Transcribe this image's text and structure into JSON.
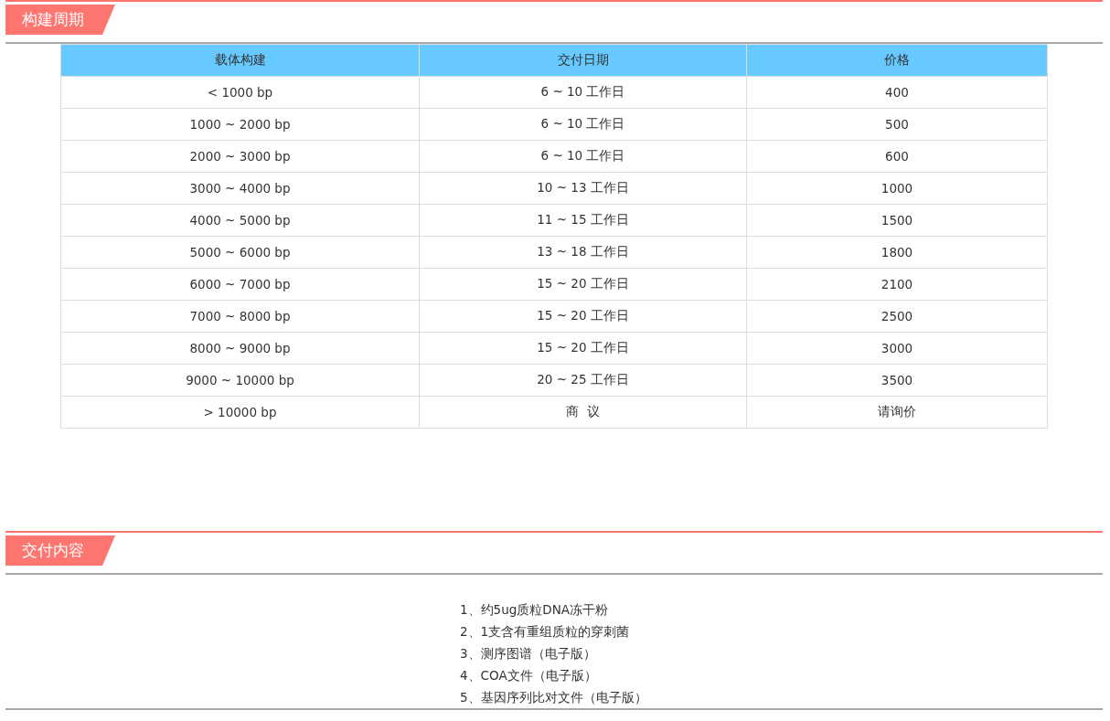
{
  "sections": [
    {
      "title": "构建周期",
      "table": {
        "columns": [
          "载体构建",
          "交付日期",
          "价格"
        ],
        "rows": [
          [
            "< 1000 bp",
            "6 ~ 10 工作日",
            "400"
          ],
          [
            "1000 ~ 2000 bp",
            "6 ~ 10 工作日",
            "500"
          ],
          [
            "2000 ~ 3000 bp",
            "6 ~ 10 工作日",
            "600"
          ],
          [
            "3000 ~ 4000 bp",
            "10 ~ 13 工作日",
            "1000"
          ],
          [
            "4000 ~ 5000 bp",
            "11 ~ 15 工作日",
            "1500"
          ],
          [
            "5000 ~ 6000 bp",
            "13 ~ 18 工作日",
            "1800"
          ],
          [
            "6000 ~ 7000 bp",
            "15 ~ 20 工作日",
            "2100"
          ],
          [
            "7000 ~ 8000 bp",
            "15 ~ 20 工作日",
            "2500"
          ],
          [
            "8000 ~ 9000 bp",
            "15 ~ 20 工作日",
            "3000"
          ],
          [
            "9000 ~ 10000 bp",
            "20 ~ 25 工作日",
            "3500"
          ],
          [
            "> 10000 bp",
            "商  议",
            "请询价"
          ]
        ]
      }
    },
    {
      "title": "交付内容",
      "items": [
        "1、约5ug质粒DNA冻干粉",
        "2、1支含有重组质粒的穿刺菌",
        "3、测序图谱（电子版）",
        "4、COA文件（电子版）",
        "5、基因序列比对文件（电子版）"
      ]
    }
  ]
}
